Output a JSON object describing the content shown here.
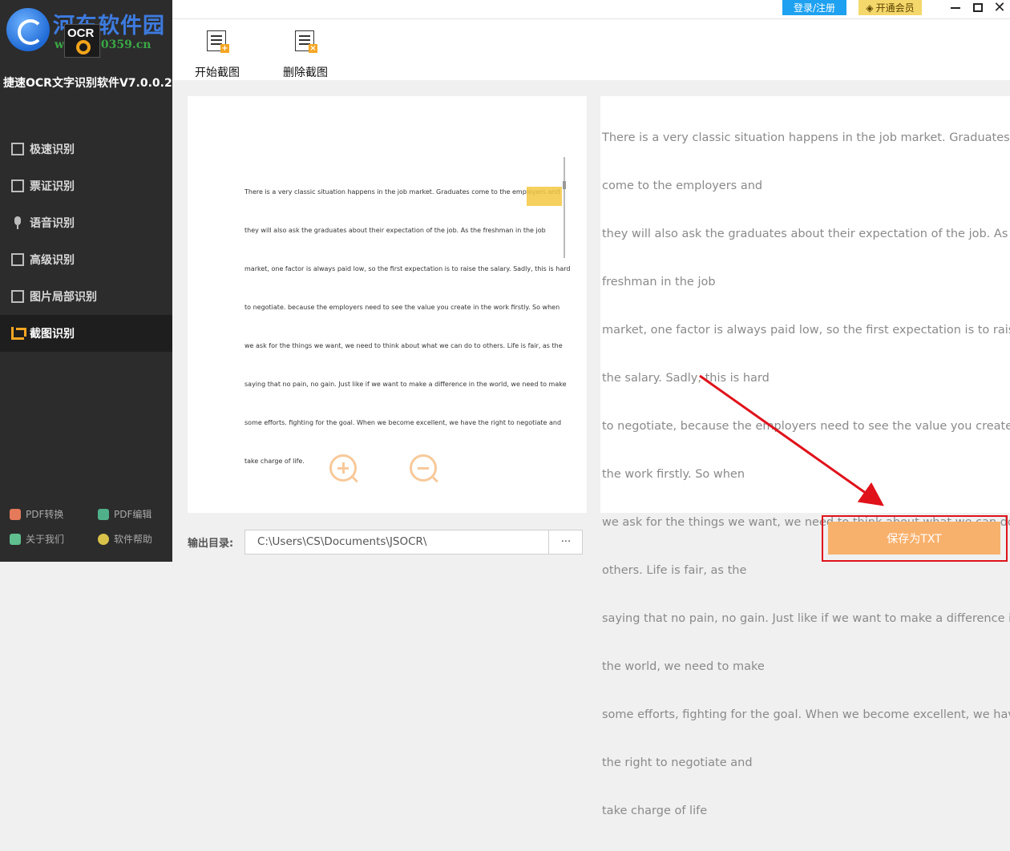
{
  "watermark": {
    "site_name": "河东软件园",
    "site_url": "www.pc0359.cn",
    "ocr_mark": "OCR"
  },
  "app": {
    "title": "捷速OCR文字识别软件V7.0.0.2"
  },
  "nav": {
    "items": [
      {
        "label": "极速识别",
        "icon": "fast-recognition-icon"
      },
      {
        "label": "票证识别",
        "icon": "ticket-recognition-icon"
      },
      {
        "label": "语音识别",
        "icon": "microphone-icon"
      },
      {
        "label": "高级识别",
        "icon": "advanced-recognition-icon"
      },
      {
        "label": "图片局部识别",
        "icon": "image-partial-icon"
      },
      {
        "label": "截图识别",
        "icon": "screenshot-crop-icon"
      }
    ],
    "active": "截图识别"
  },
  "footer": {
    "pdf_convert": "PDF转换",
    "pdf_edit": "PDF编辑",
    "about": "关于我们",
    "help": "软件帮助"
  },
  "topbar": {
    "login": "登录/注册",
    "vip": "开通会员"
  },
  "toolbar": {
    "start_screenshot": "开始截图",
    "delete_screenshot": "删除截图"
  },
  "preview": {
    "lines": [
      "There is a very classic situation happens in the job market. Graduates come to the employers and",
      "they will also ask the graduates about their expectation of the job. As the freshman in the job",
      "market, one factor is always paid low, so the first expectation is to raise the salary. Sadly, this is hard",
      "to negotiate. because the employers need to see the value you create in the work firstly. So when",
      "we ask for the things we want, we need to think about what we can do to others. Life is fair, as the",
      "saying that no pain, no gain. Just like if we want to make a difference in the world, we need to make",
      "some efforts. fighting for the goal. When we become excellent, we have the right to negotiate and",
      "take charge of life."
    ]
  },
  "result": {
    "lines": [
      "There is a very classic situation happens in the job market. Graduates",
      "come to the employers and",
      "they will also ask the graduates about their expectation of the job. As the",
      "freshman in the job",
      "market, one factor is always paid low, so the first expectation is to raise",
      "the salary. Sadly, this is hard",
      "to negotiate, because the employers need to see the value you create in",
      "the work firstly. So when",
      "we ask for the things we want, we need to think about what we can do to",
      "others. Life is fair, as the",
      "saying that no pain, no gain. Just like if we want to make a difference in",
      "the world, we need to make",
      "some efforts, fighting for the goal. When we become excellent, we have",
      "the right to negotiate and",
      "take charge of life"
    ]
  },
  "output": {
    "label": "输出目录:",
    "path": "C:\\Users\\CS\\Documents\\JSOCR\\",
    "browse": "···"
  },
  "save_button": "保存为TXT",
  "colors": {
    "sidebar_bg": "#2c2c2c",
    "accent_orange": "#f5a623",
    "save_button_bg": "#f8b16c",
    "login_blue": "#1ea1f0",
    "vip_yellow": "#f5d86b",
    "annotation_red": "#e0121a"
  }
}
